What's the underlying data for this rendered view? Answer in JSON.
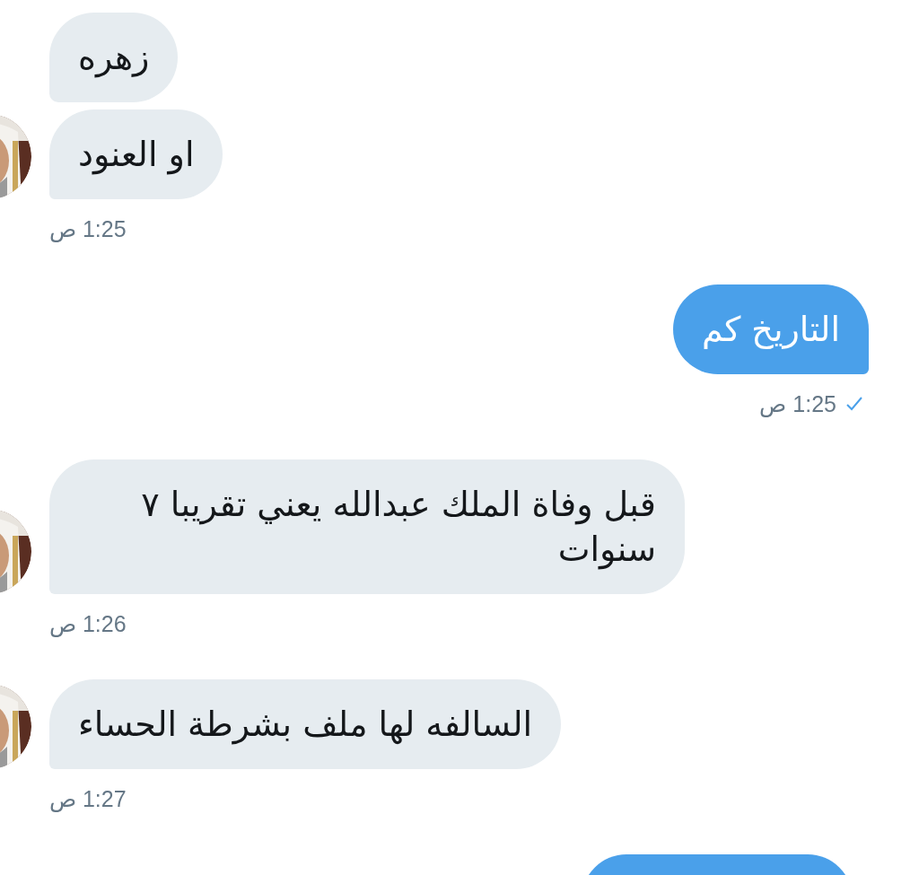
{
  "groups": [
    {
      "kind": "received",
      "bubbles": [
        "زهره",
        "او العنود"
      ],
      "time": "1:25 ص",
      "avatar": true
    },
    {
      "kind": "sent",
      "bubbles": [
        "التاريخ كم"
      ],
      "time": "1:25 ص",
      "read": true
    },
    {
      "kind": "received",
      "bubbles": [
        "قبل وفاة الملك عبدالله يعني تقريبا ٧ سنوات"
      ],
      "time": "1:26 ص",
      "avatar": true
    },
    {
      "kind": "received",
      "bubbles": [
        "السالفه لها ملف بشرطة الحساء"
      ],
      "time": "1:27 ص",
      "avatar": true
    },
    {
      "kind": "sent",
      "cut_off": true
    }
  ]
}
